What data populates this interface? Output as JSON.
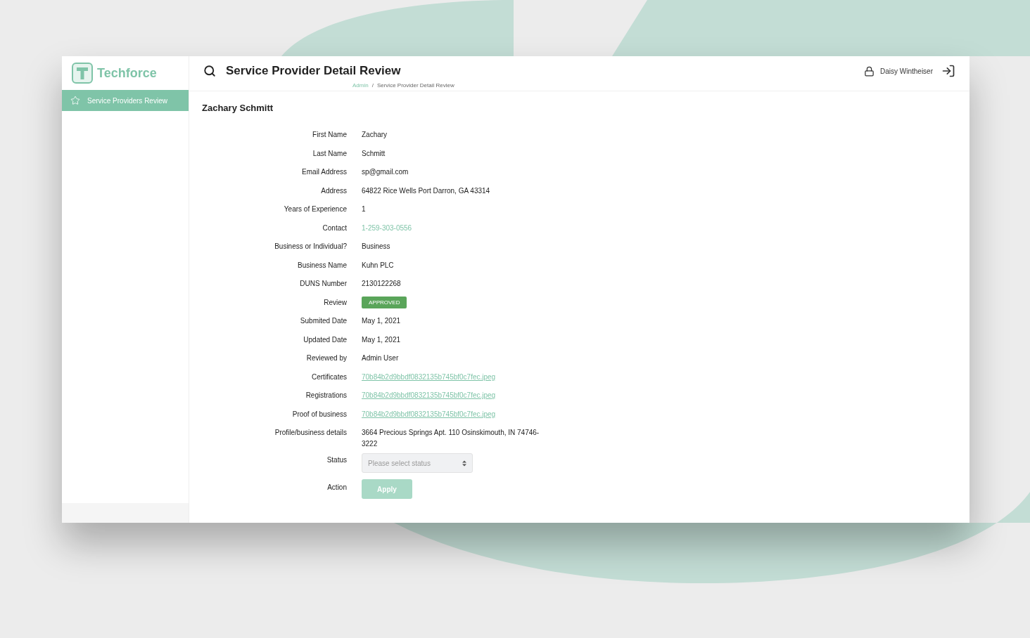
{
  "app": {
    "logo_text": "Techforce"
  },
  "sidebar": {
    "items": [
      {
        "label": "Service Providers Review",
        "selected": true
      }
    ]
  },
  "header": {
    "title": "Service Provider Detail Review",
    "user_name": "Daisy Wintheiser"
  },
  "breadcrumb": [
    {
      "label": "Admin",
      "kind": "link"
    },
    {
      "label": "/",
      "kind": "separator"
    },
    {
      "label": "Service Provider Detail Review",
      "kind": "current"
    }
  ],
  "provider_name": "Zachary Schmitt",
  "fields": [
    {
      "label": "First Name",
      "kind": "text",
      "value": "Zachary"
    },
    {
      "label": "Last Name",
      "kind": "text",
      "value": "Schmitt"
    },
    {
      "label": "Email Address",
      "kind": "text",
      "value": "sp@gmail.com"
    },
    {
      "label": "Address",
      "kind": "text",
      "value": "64822 Rice Wells Port Darron, GA 43314"
    },
    {
      "label": "Years of Experience",
      "kind": "text",
      "value": "1"
    },
    {
      "label": "Contact",
      "kind": "phone",
      "value": "1-259-303-0556"
    },
    {
      "label": "Business or Individual?",
      "kind": "text",
      "value": "Business"
    },
    {
      "label": "Business Name",
      "kind": "text",
      "value": "Kuhn PLC"
    },
    {
      "label": "DUNS Number",
      "kind": "text",
      "value": "2130122268"
    },
    {
      "label": "Review",
      "kind": "badge",
      "value": "APPROVED",
      "color": "#5aa55a"
    },
    {
      "label": "Submited Date",
      "kind": "text",
      "value": "May 1, 2021"
    },
    {
      "label": "Updated Date",
      "kind": "text",
      "value": "May 1, 2021"
    },
    {
      "label": "Reviewed by",
      "kind": "text",
      "value": "Admin User"
    },
    {
      "label": "Certificates",
      "kind": "file",
      "value": "70b84b2d9bbdf0832135b745bf0c7fec.jpeg"
    },
    {
      "label": "Registrations",
      "kind": "file",
      "value": "70b84b2d9bbdf0832135b745bf0c7fec.jpeg"
    },
    {
      "label": "Proof of business",
      "kind": "file",
      "value": "70b84b2d9bbdf0832135b745bf0c7fec.jpeg"
    },
    {
      "label": "Profile/business details",
      "kind": "text",
      "value": "3664 Precious Springs Apt. 110 Osinskimouth, IN 74746-3222"
    },
    {
      "label": "Status",
      "kind": "select",
      "placeholder": "Please select status"
    },
    {
      "label": "Action",
      "kind": "button",
      "value": "Apply",
      "disabled": true
    }
  ]
}
